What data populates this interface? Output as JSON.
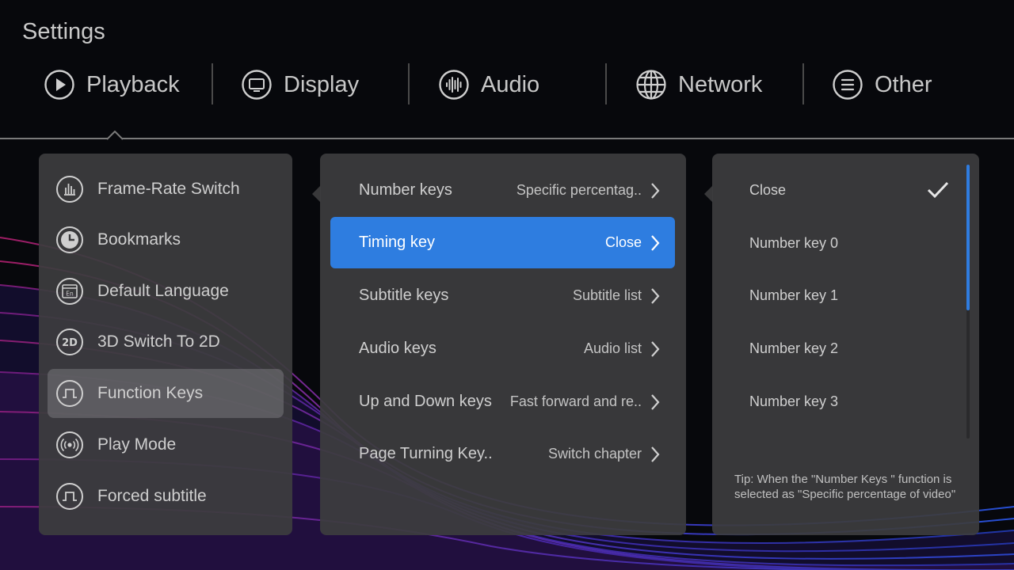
{
  "page_title": "Settings",
  "tabs": [
    {
      "label": "Playback",
      "icon": "play-icon"
    },
    {
      "label": "Display",
      "icon": "monitor-icon"
    },
    {
      "label": "Audio",
      "icon": "audio-waveform-icon"
    },
    {
      "label": "Network",
      "icon": "globe-icon"
    },
    {
      "label": "Other",
      "icon": "menu-lines-icon"
    }
  ],
  "selected_tab": "Playback",
  "menu": {
    "items": [
      {
        "label": "Frame-Rate Switch",
        "icon": "bar-chart-icon"
      },
      {
        "label": "Bookmarks",
        "icon": "clock-icon"
      },
      {
        "label": "Default Language",
        "icon": "language-icon"
      },
      {
        "label": "3D Switch To 2D",
        "icon": "2d-icon"
      },
      {
        "label": "Function Keys",
        "icon": "pulse-wave-icon"
      },
      {
        "label": "Play Mode",
        "icon": "broadcast-icon"
      },
      {
        "label": "Forced subtitle",
        "icon": "pulse-wave-icon"
      }
    ],
    "selected": "Function Keys"
  },
  "options": {
    "rows": [
      {
        "label": "Number keys",
        "value": "Specific percentag.."
      },
      {
        "label": "Timing key",
        "value": "Close"
      },
      {
        "label": "Subtitle keys",
        "value": "Subtitle list"
      },
      {
        "label": "Audio keys",
        "value": "Audio list"
      },
      {
        "label": "Up and Down keys",
        "value": "Fast forward and re.."
      },
      {
        "label": "Page Turning Key..",
        "value": "Switch chapter"
      }
    ],
    "active": "Timing key"
  },
  "choices": {
    "items": [
      {
        "label": "Close"
      },
      {
        "label": "Number key 0"
      },
      {
        "label": "Number key 1"
      },
      {
        "label": "Number key 2"
      },
      {
        "label": "Number key 3"
      }
    ],
    "checked": "Close",
    "scroll_visible_fraction": 0.53,
    "tip": "Tip: When the \"Number Keys \" function is selected as \"Specific percentage of video\""
  },
  "colors": {
    "accent": "#2e7de0",
    "panel": "#3c3c3e",
    "background": "#07080c"
  }
}
